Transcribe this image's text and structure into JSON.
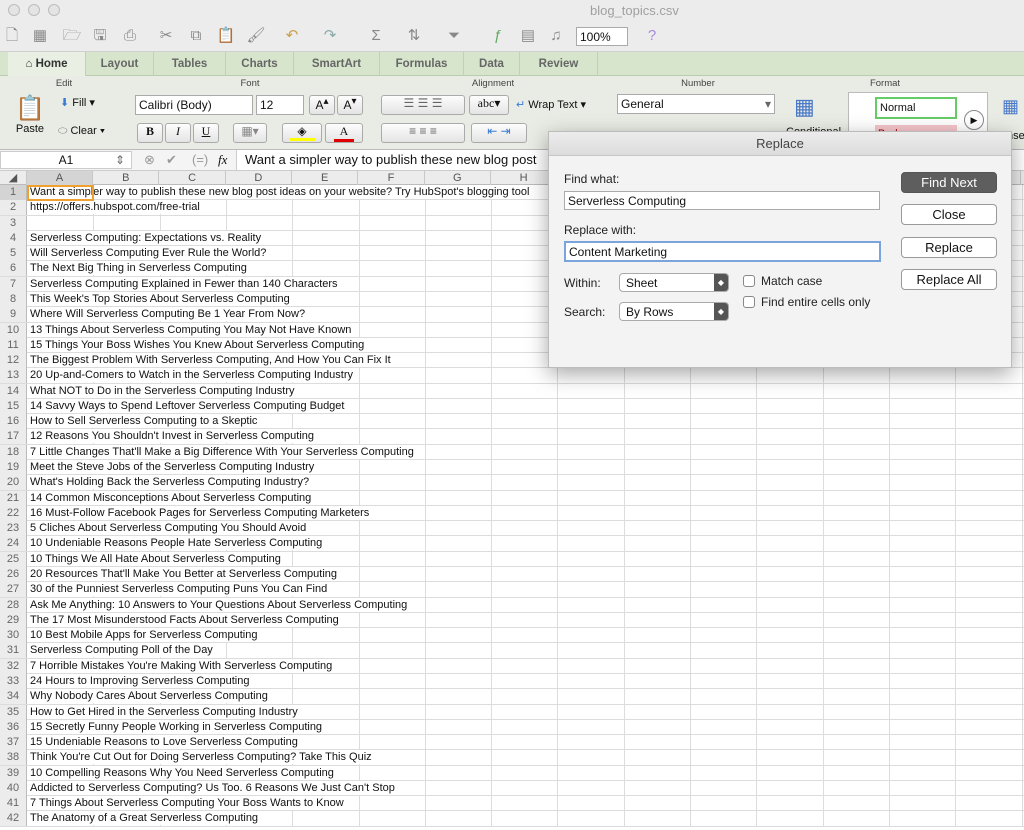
{
  "window": {
    "title": "blog_topics.csv"
  },
  "toolbar": {
    "zoom": "100%"
  },
  "tabs": [
    {
      "label": "Home",
      "icon": "home-icon",
      "active": true
    },
    {
      "label": "Layout"
    },
    {
      "label": "Tables"
    },
    {
      "label": "Charts"
    },
    {
      "label": "SmartArt"
    },
    {
      "label": "Formulas"
    },
    {
      "label": "Data"
    },
    {
      "label": "Review"
    }
  ],
  "ribbon": {
    "groups": {
      "edit": "Edit",
      "font": "Font",
      "alignment": "Alignment",
      "number": "Number",
      "format": "Format"
    },
    "paste": "Paste",
    "fill": "Fill",
    "clear": "Clear",
    "font_name": "Calibri (Body)",
    "font_size": "12",
    "bold": "B",
    "italic": "I",
    "underline": "U",
    "abc": "abc",
    "wrap_text": "Wrap Text",
    "number_format": "General",
    "conditional": "Conditional",
    "style_normal": "Normal",
    "style_bad": "Bad",
    "insert": "Inse",
    "fill_color": "#ffff00",
    "font_color": "#e00000"
  },
  "formula_bar": {
    "cell_ref": "A1",
    "fx": "fx",
    "content": "Want a simpler way to publish these new blog post"
  },
  "columns": [
    "A",
    "B",
    "C",
    "D",
    "E",
    "F",
    "G",
    "H",
    "I",
    "J",
    "K",
    "L",
    "M",
    "N",
    "O"
  ],
  "rows": [
    "Want a simpler way to publish these new blog post ideas on your website? Try HubSpot's blogging tool",
    "https://offers.hubspot.com/free-trial",
    "",
    "Serverless Computing: Expectations vs. Reality",
    "Will Serverless Computing Ever Rule the World?",
    "The Next Big Thing in Serverless Computing",
    "Serverless Computing Explained in Fewer than 140 Characters",
    "This Week's Top Stories About Serverless Computing",
    "Where Will Serverless Computing Be 1 Year From Now?",
    "13 Things About Serverless Computing You May Not Have Known",
    "15 Things Your Boss Wishes You Knew About Serverless Computing",
    "The Biggest Problem With Serverless Computing, And How You Can Fix It",
    "20 Up-and-Comers to Watch in the Serverless Computing Industry",
    "What NOT to Do in the Serverless Computing Industry",
    "14 Savvy Ways to Spend Leftover Serverless Computing Budget",
    "How to Sell Serverless Computing to a Skeptic",
    "12 Reasons You Shouldn't Invest in Serverless Computing",
    "7 Little Changes That'll Make a Big Difference With Your Serverless Computing",
    "Meet the Steve Jobs of the Serverless Computing Industry",
    "What's Holding Back the Serverless Computing Industry?",
    "14 Common Misconceptions About Serverless Computing",
    "16 Must-Follow Facebook Pages for Serverless Computing Marketers",
    "5 Cliches About Serverless Computing You Should Avoid",
    "10 Undeniable Reasons People Hate Serverless Computing",
    "10 Things We All Hate About Serverless Computing",
    "20 Resources That'll Make You Better at Serverless Computing",
    "30 of the Punniest Serverless Computing Puns You Can Find",
    "Ask Me Anything: 10 Answers to Your Questions About Serverless Computing",
    "The 17 Most Misunderstood Facts About Serverless Computing",
    "10 Best Mobile Apps for Serverless Computing",
    "Serverless Computing Poll of the Day",
    "7 Horrible Mistakes You're Making With Serverless Computing",
    "24 Hours to Improving Serverless Computing",
    "Why Nobody Cares About Serverless Computing",
    "How to Get Hired in the Serverless Computing Industry",
    "15 Secretly Funny People Working in Serverless Computing",
    "15 Undeniable Reasons to Love Serverless Computing",
    "Think You're Cut Out for Doing Serverless Computing? Take This Quiz",
    "10 Compelling Reasons Why You Need Serverless Computing",
    "Addicted to Serverless Computing? Us Too. 6 Reasons We Just Can't Stop",
    "7 Things About Serverless Computing Your Boss Wants to Know",
    "The Anatomy of a Great Serverless Computing"
  ],
  "dialog": {
    "title": "Replace",
    "find_label": "Find what:",
    "find_value": "Serverless Computing",
    "replace_label": "Replace with:",
    "replace_value": "Content Marketing",
    "within_label": "Within:",
    "within_value": "Sheet",
    "search_label": "Search:",
    "search_value": "By Rows",
    "match_case": "Match case",
    "match_case_checked": false,
    "entire_cells": "Find entire cells only",
    "entire_cells_checked": false,
    "find_next": "Find Next",
    "close": "Close",
    "replace": "Replace",
    "replace_all": "Replace All"
  }
}
